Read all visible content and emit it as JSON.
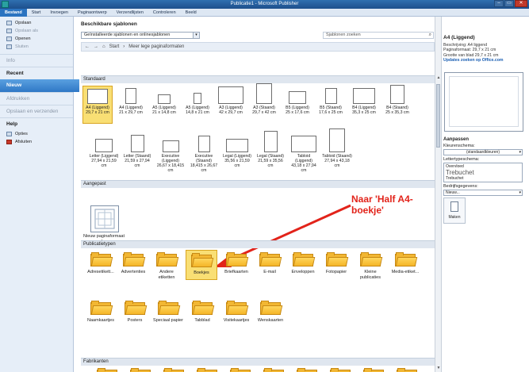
{
  "window": {
    "title": "Publicatie1 - Microsoft Publisher",
    "controls": [
      "–",
      "▭",
      "✕"
    ]
  },
  "ribbon": {
    "tabs": [
      "Bestand",
      "Start",
      "Invoegen",
      "Paginaontwerp",
      "Verzendlijsten",
      "Controleren",
      "Beeld"
    ]
  },
  "nav": {
    "top_items": [
      {
        "label": "Opslaan",
        "icon": "save-icon",
        "dim": false
      },
      {
        "label": "Opslaan als",
        "icon": "save-as-icon",
        "dim": true
      },
      {
        "label": "Openen",
        "icon": "open-folder-icon",
        "dim": false
      },
      {
        "label": "Sluiten",
        "icon": "close-document-icon",
        "dim": true
      }
    ],
    "info": "Info",
    "recent": "Recent",
    "nieuw": "Nieuw",
    "afdrukken": "Afdrukken",
    "opslaan_verzenden": "Opslaan en verzenden",
    "help": "Help",
    "opties": "Opties",
    "afsluiten": "Afsluiten"
  },
  "main": {
    "heading": "Beschikbare sjablonen",
    "filter": "Geïnstalleerde sjablonen en onlinesjablonen",
    "search_placeholder": "Sjablonen zoeken",
    "breadcrumb": {
      "back": "←",
      "forward": "→",
      "home": "Start",
      "sep": "›",
      "current": "Meer lege paginaformaten"
    },
    "sections": {
      "standaard": "Standaard",
      "aangepast": "Aangepast",
      "publicatietypen": "Publicatietypen",
      "fabrikanten": "Fabrikanten"
    },
    "standaard_tiles": [
      {
        "name": "A4 (Liggend)",
        "size": "29,7 x 21 cm"
      },
      {
        "name": "A4 (Liggend)",
        "size": "21 x 29,7 cm"
      },
      {
        "name": "A5 (Liggend)",
        "size": "21 x 14,8 cm"
      },
      {
        "name": "A5 (Liggend)",
        "size": "14,8 x 21 cm"
      },
      {
        "name": "A3 (Liggend)",
        "size": "42 x 29,7 cm"
      },
      {
        "name": "A3 (Staand)",
        "size": "29,7 x 42 cm"
      },
      {
        "name": "B5 (Liggend)",
        "size": "25 x 17,6 cm"
      },
      {
        "name": "B5 (Staand)",
        "size": "17,6 x 25 cm"
      },
      {
        "name": "B4 (Liggend)",
        "size": "35,3 x 25 cm"
      },
      {
        "name": "B4 (Staand)",
        "size": "25 x 35,3 cm"
      }
    ],
    "standaard_tiles_row2": [
      {
        "name": "Letter (Liggend)",
        "size": "27,94 x 21,59 cm"
      },
      {
        "name": "Letter (Staand)",
        "size": "21,59 x 27,94 cm"
      },
      {
        "name": "Executive (Liggend)",
        "size": "26,67 x 18,415 cm"
      },
      {
        "name": "Executive (Staand)",
        "size": "18,415 x 26,67 cm"
      },
      {
        "name": "Legal (Liggend)",
        "size": "35,56 x 21,59 cm"
      },
      {
        "name": "Legal (Staand)",
        "size": "21,59 x 35,56 cm"
      },
      {
        "name": "Tabloid (Liggend)",
        "size": "43,18 x 27,94 cm"
      },
      {
        "name": "Tabloid (Staand)",
        "size": "27,94 x 43,18 cm"
      }
    ],
    "custom_tile": "Nieuw paginaformaat maken...",
    "annotation": "Naar 'Half A4-boekje'",
    "pub_types_row1": [
      "Adresetikett...",
      "Advertenties",
      "Andere etiketten",
      "Boekjes",
      "Briefkaarten",
      "E-mail",
      "Enveloppen",
      "Fotopapier",
      "Kleine publicaties",
      "Media-etiket..."
    ],
    "pub_types_row2": [
      "Naamkaartjes",
      "Posters",
      "Speciaal papier",
      "Tabblad",
      "Visitekaartjes",
      "Wenskaarten"
    ],
    "colors": {
      "selection": "#f9df74",
      "annotation": "#e2231a",
      "nav_active": "#2f78c6"
    }
  },
  "right": {
    "title": "A4 (Liggend)",
    "info_lines": [
      "Beschrijving: A4 liggend",
      "Paginaformaat: 29,7 x 21 cm",
      "Grootte van blad 29,7 x 21 cm"
    ],
    "link": "Updates zoeken op Office.com",
    "aanpassen": "Aanpassen",
    "kleurenschema_label": "Kleurenschema:",
    "kleurenschema_value": "(standaardkleuren)",
    "letterschema_label": "Lettertypeschema:",
    "letterschema_value": [
      "Overvloed",
      "Trebuchet",
      "Trebuchet"
    ],
    "bedrijf_label": "Bedrijfsgegevens:",
    "bedrijf_value": "Nieuw...",
    "maken": "Maken"
  }
}
